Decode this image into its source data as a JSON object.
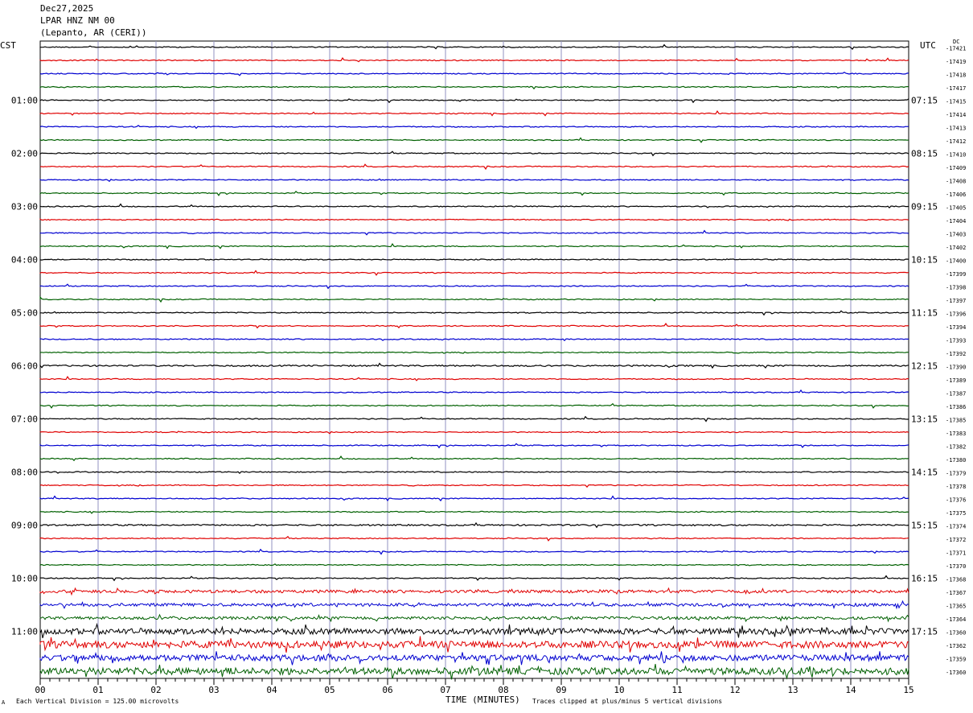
{
  "header": {
    "date": "Dec27,2025",
    "station": "LPAR HNZ NM 00",
    "location": "(Lepanto, AR (CERI))"
  },
  "left_tz": "CST",
  "right_tz": "UTC",
  "dc_label": "DC",
  "footer": {
    "corner_mark": "A",
    "scale_note": "Each Vertical Division = 125.00 microvolts",
    "xlabel": "TIME (MINUTES)",
    "clip_note": "Traces clipped at plus/minus 5 vertical divisions"
  },
  "colors": {
    "trace_cycle": [
      "#000000",
      "#e00000",
      "#0000d0",
      "#006000"
    ],
    "grid": "#9090c0"
  },
  "chart_data": {
    "type": "line",
    "title": "LPAR HNZ NM 00",
    "xlabel": "TIME (MINUTES)",
    "xlim": [
      0,
      15
    ],
    "x_ticks": [
      "00",
      "01",
      "02",
      "03",
      "04",
      "05",
      "06",
      "07",
      "08",
      "09",
      "10",
      "11",
      "12",
      "13",
      "14",
      "15"
    ],
    "left_hour_labels": [
      "01:00",
      "02:00",
      "03:00",
      "04:00",
      "05:00",
      "06:00",
      "07:00",
      "08:00",
      "09:00",
      "10:00",
      "11:00"
    ],
    "right_hour_labels": [
      "07:15",
      "08:15",
      "09:15",
      "10:15",
      "11:15",
      "12:15",
      "13:15",
      "14:15",
      "15:15",
      "16:15",
      "17:15"
    ],
    "dc_offsets": [
      "-17421",
      "-17419",
      "-17418",
      "-17417",
      "-17415",
      "-17414",
      "-17413",
      "-17412",
      "-17410",
      "-17409",
      "-17408",
      "-17406",
      "-17405",
      "-17404",
      "-17403",
      "-17402",
      "-17400",
      "-17399",
      "-17398",
      "-17397",
      "-17396",
      "-17394",
      "-17393",
      "-17392",
      "-17390",
      "-17389",
      "-17387",
      "-17386",
      "-17385",
      "-17383",
      "-17382",
      "-17380",
      "-17379",
      "-17378",
      "-17376",
      "-17375",
      "-17374",
      "-17372",
      "-17371",
      "-17370",
      "-17368",
      "-17367",
      "-17365",
      "-17364",
      "-17360",
      "-17362",
      "-17359",
      "-17360"
    ],
    "trace_noise_level": [
      1,
      1,
      1,
      1,
      1,
      1,
      1,
      1,
      1,
      1,
      1,
      1,
      1,
      1,
      1,
      1,
      1,
      1,
      1,
      1,
      1,
      1,
      1,
      1,
      1.5,
      1,
      1,
      1,
      1,
      1,
      1,
      1,
      1,
      1,
      1,
      1,
      1.5,
      1,
      1,
      1,
      1,
      3,
      3,
      3,
      6,
      7,
      6,
      7
    ]
  }
}
